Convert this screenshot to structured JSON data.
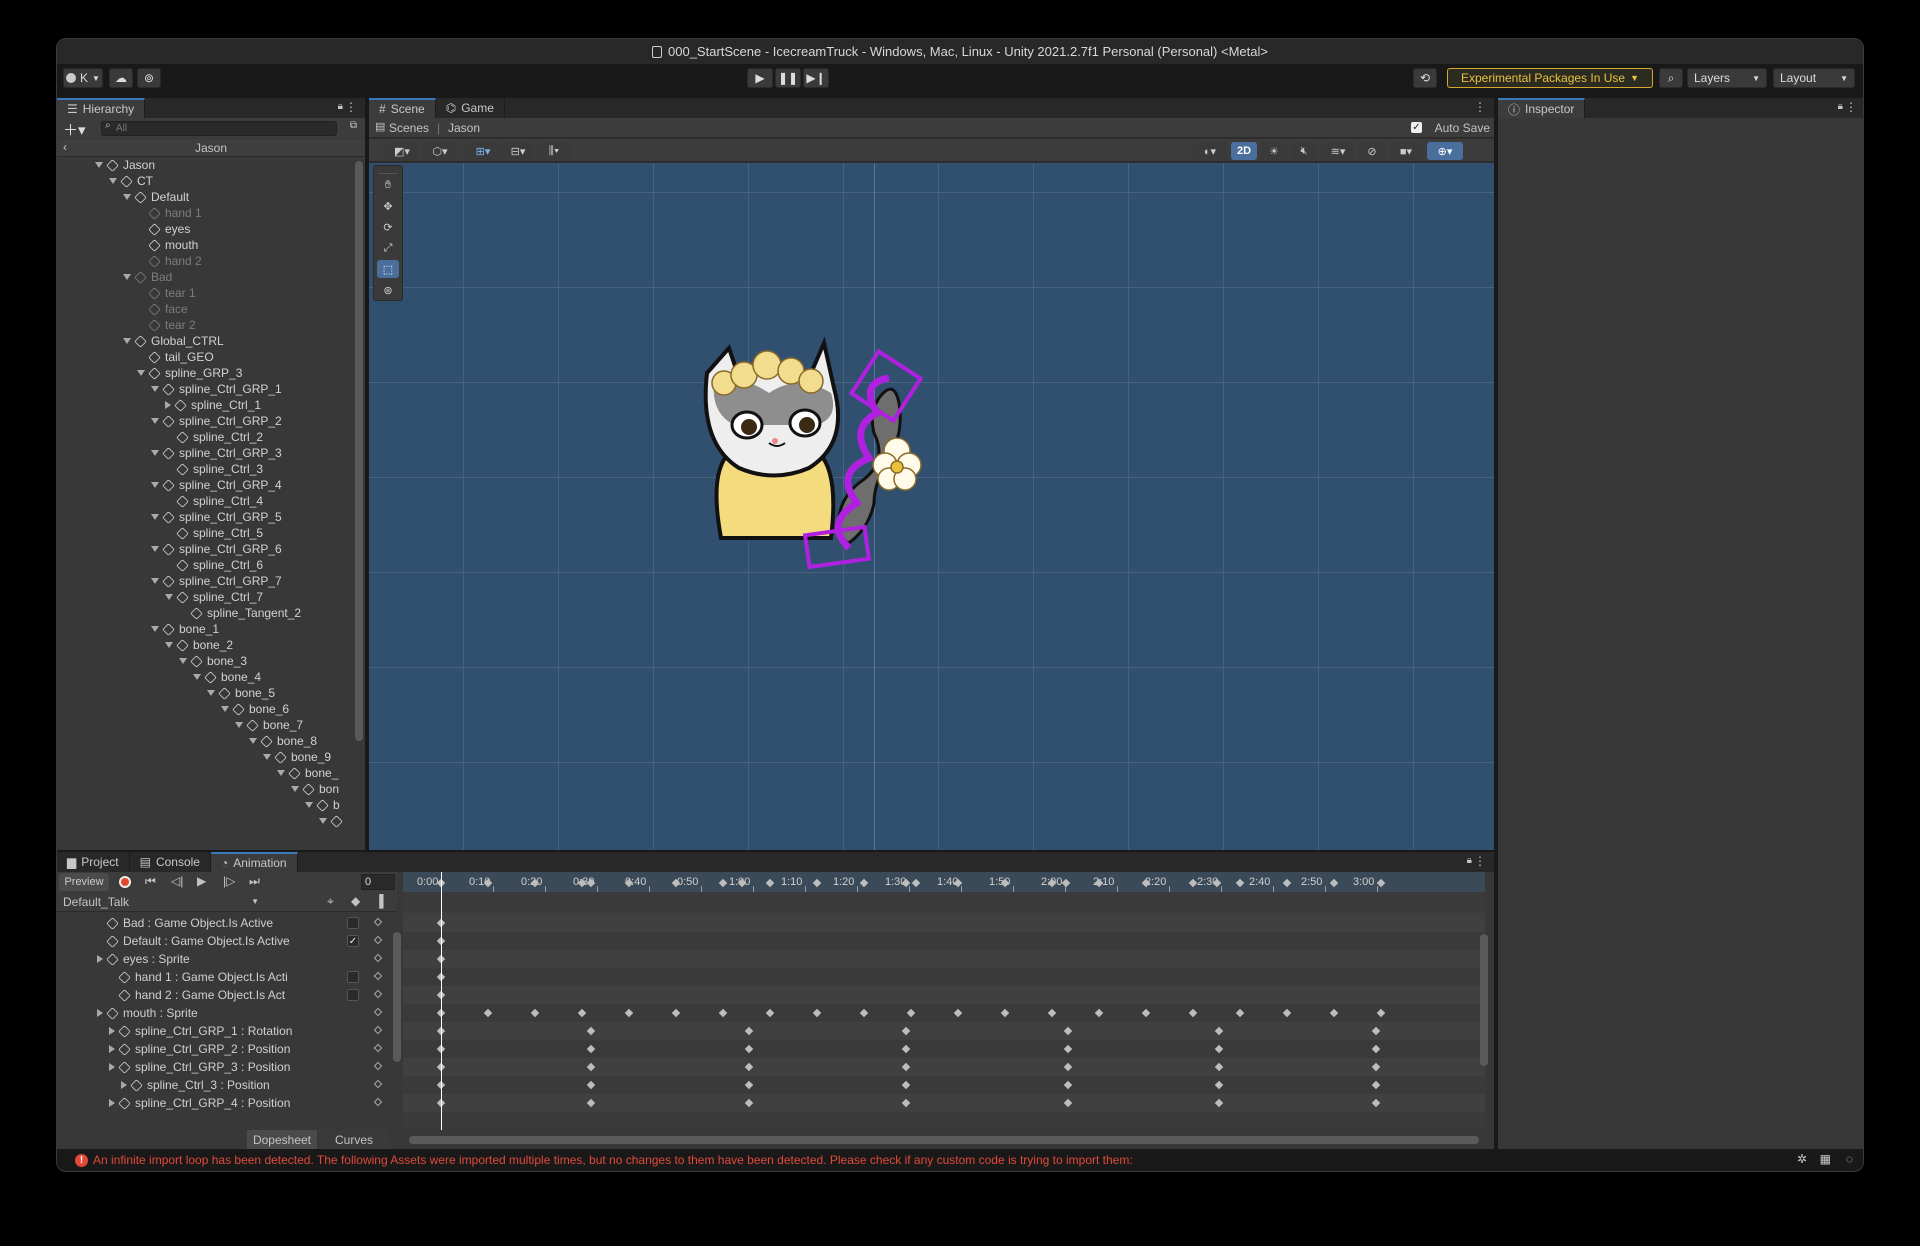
{
  "window": {
    "title": "000_StartScene - IcecreamTruck - Windows, Mac, Linux - Unity 2021.2.7f1 Personal (Personal) <Metal>"
  },
  "toolbar": {
    "account": "K",
    "experimental": "Experimental Packages In Use",
    "layers": "Layers",
    "layout": "Layout"
  },
  "hierarchy": {
    "tab": "Hierarchy",
    "search_placeholder": "All",
    "context": "Jason",
    "items": [
      {
        "label": "Jason",
        "depth": 0,
        "arrow": "down",
        "dim": false
      },
      {
        "label": "CT",
        "depth": 1,
        "arrow": "down",
        "dim": false
      },
      {
        "label": "Default",
        "depth": 2,
        "arrow": "down",
        "dim": false
      },
      {
        "label": "hand 1",
        "depth": 3,
        "arrow": "",
        "dim": true
      },
      {
        "label": "eyes",
        "depth": 3,
        "arrow": "",
        "dim": false
      },
      {
        "label": "mouth",
        "depth": 3,
        "arrow": "",
        "dim": false
      },
      {
        "label": "hand 2",
        "depth": 3,
        "arrow": "",
        "dim": true
      },
      {
        "label": "Bad",
        "depth": 2,
        "arrow": "down",
        "dim": true
      },
      {
        "label": "tear 1",
        "depth": 3,
        "arrow": "",
        "dim": true
      },
      {
        "label": "face",
        "depth": 3,
        "arrow": "",
        "dim": true
      },
      {
        "label": "tear 2",
        "depth": 3,
        "arrow": "",
        "dim": true
      },
      {
        "label": "Global_CTRL",
        "depth": 2,
        "arrow": "down",
        "dim": false
      },
      {
        "label": "tail_GEO",
        "depth": 3,
        "arrow": "",
        "dim": false
      },
      {
        "label": "spline_GRP_3",
        "depth": 3,
        "arrow": "down",
        "dim": false
      },
      {
        "label": "spline_Ctrl_GRP_1",
        "depth": 4,
        "arrow": "down",
        "dim": false
      },
      {
        "label": "spline_Ctrl_1",
        "depth": 5,
        "arrow": "right",
        "dim": false
      },
      {
        "label": "spline_Ctrl_GRP_2",
        "depth": 4,
        "arrow": "down",
        "dim": false
      },
      {
        "label": "spline_Ctrl_2",
        "depth": 5,
        "arrow": "",
        "dim": false
      },
      {
        "label": "spline_Ctrl_GRP_3",
        "depth": 4,
        "arrow": "down",
        "dim": false
      },
      {
        "label": "spline_Ctrl_3",
        "depth": 5,
        "arrow": "",
        "dim": false
      },
      {
        "label": "spline_Ctrl_GRP_4",
        "depth": 4,
        "arrow": "down",
        "dim": false
      },
      {
        "label": "spline_Ctrl_4",
        "depth": 5,
        "arrow": "",
        "dim": false
      },
      {
        "label": "spline_Ctrl_GRP_5",
        "depth": 4,
        "arrow": "down",
        "dim": false
      },
      {
        "label": "spline_Ctrl_5",
        "depth": 5,
        "arrow": "",
        "dim": false
      },
      {
        "label": "spline_Ctrl_GRP_6",
        "depth": 4,
        "arrow": "down",
        "dim": false
      },
      {
        "label": "spline_Ctrl_6",
        "depth": 5,
        "arrow": "",
        "dim": false
      },
      {
        "label": "spline_Ctrl_GRP_7",
        "depth": 4,
        "arrow": "down",
        "dim": false
      },
      {
        "label": "spline_Ctrl_7",
        "depth": 5,
        "arrow": "down",
        "dim": false
      },
      {
        "label": "spline_Tangent_2",
        "depth": 6,
        "arrow": "",
        "dim": false
      },
      {
        "label": "bone_1",
        "depth": 4,
        "arrow": "down",
        "dim": false
      },
      {
        "label": "bone_2",
        "depth": 5,
        "arrow": "down",
        "dim": false
      },
      {
        "label": "bone_3",
        "depth": 6,
        "arrow": "down",
        "dim": false
      },
      {
        "label": "bone_4",
        "depth": 7,
        "arrow": "down",
        "dim": false
      },
      {
        "label": "bone_5",
        "depth": 8,
        "arrow": "down",
        "dim": false
      },
      {
        "label": "bone_6",
        "depth": 9,
        "arrow": "down",
        "dim": false
      },
      {
        "label": "bone_7",
        "depth": 10,
        "arrow": "down",
        "dim": false
      },
      {
        "label": "bone_8",
        "depth": 11,
        "arrow": "down",
        "dim": false
      },
      {
        "label": "bone_9",
        "depth": 12,
        "arrow": "down",
        "dim": false
      },
      {
        "label": "bone_",
        "depth": 13,
        "arrow": "down",
        "dim": false
      },
      {
        "label": "bon",
        "depth": 14,
        "arrow": "down",
        "dim": false
      },
      {
        "label": "b",
        "depth": 15,
        "arrow": "down",
        "dim": false
      },
      {
        "label": "",
        "depth": 16,
        "arrow": "down",
        "dim": false
      }
    ]
  },
  "scene": {
    "tabs": [
      "Scene",
      "Game"
    ],
    "breadcrumb_root": "Scenes",
    "breadcrumb_current": "Jason",
    "auto_save": "Auto Save",
    "mode_2d": "2D"
  },
  "inspector": {
    "tab": "Inspector"
  },
  "bottom": {
    "tabs": [
      "Project",
      "Console",
      "Animation"
    ],
    "preview": "Preview",
    "frame": "0",
    "clip": "Default_Talk",
    "dopesheet": "Dopesheet",
    "curves": "Curves",
    "ruler": [
      "0:00",
      "0:10",
      "0:20",
      "0:30",
      "0:40",
      "0:50",
      "1:00",
      "1:10",
      "1:20",
      "1:30",
      "1:40",
      "1:50",
      "2:00",
      "2:10",
      "2:20",
      "2:30",
      "2:40",
      "2:50",
      "3:00"
    ],
    "properties": [
      {
        "label": "Bad : Game Object.Is Active",
        "indent": 1,
        "expander": false,
        "toggle": "off"
      },
      {
        "label": "Default : Game Object.Is Active",
        "indent": 1,
        "expander": false,
        "toggle": "on"
      },
      {
        "label": "eyes : Sprite",
        "indent": 1,
        "expander": true,
        "toggle": ""
      },
      {
        "label": "hand 1 : Game Object.Is Acti",
        "indent": 2,
        "expander": false,
        "toggle": "off"
      },
      {
        "label": "hand 2 : Game Object.Is Act",
        "indent": 2,
        "expander": false,
        "toggle": "off"
      },
      {
        "label": "mouth : Sprite",
        "indent": 1,
        "expander": true,
        "toggle": ""
      },
      {
        "label": "spline_Ctrl_GRP_1 : Rotation",
        "indent": 2,
        "expander": true,
        "toggle": ""
      },
      {
        "label": "spline_Ctrl_GRP_2 : Position",
        "indent": 2,
        "expander": true,
        "toggle": ""
      },
      {
        "label": "spline_Ctrl_GRP_3 : Position",
        "indent": 2,
        "expander": true,
        "toggle": ""
      },
      {
        "label": "spline_Ctrl_3 : Position",
        "indent": 3,
        "expander": true,
        "toggle": ""
      },
      {
        "label": "spline_Ctrl_GRP_4 : Position",
        "indent": 2,
        "expander": true,
        "toggle": ""
      }
    ]
  },
  "status": {
    "message": "An infinite import loop has been detected. The following Assets were imported multiple times, but no changes to them have been detected. Please check if any custom code is trying to import them:"
  },
  "colors": {
    "accent": "#3a79bb",
    "error": "#e04a3a",
    "warning": "#e8c23a",
    "scene_bg": "#31506f",
    "spline": "#b020e0"
  }
}
